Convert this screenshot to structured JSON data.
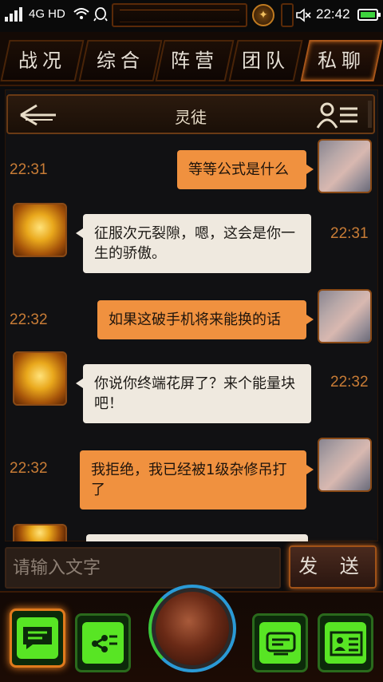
{
  "status_bar": {
    "network": "4G HD",
    "time": "22:42"
  },
  "tabs": [
    {
      "label": "战况",
      "active": false
    },
    {
      "label": "综合",
      "active": false
    },
    {
      "label": "阵营",
      "active": false
    },
    {
      "label": "团队",
      "active": false
    },
    {
      "label": "私聊",
      "active": true
    }
  ],
  "chat_header": {
    "title": "灵徒",
    "back_icon": "back-arrow-icon",
    "members_icon": "member-list-icon"
  },
  "messages": [
    {
      "direction": "out",
      "time": "22:31",
      "text": "等等公式是什么"
    },
    {
      "direction": "in",
      "time": "22:31",
      "text": "征服次元裂隙，嗯，这会是你一生的骄傲。"
    },
    {
      "direction": "out",
      "time": "22:32",
      "text": "如果这破手机将来能换的话"
    },
    {
      "direction": "in",
      "time": "22:32",
      "text": "你说你终端花屏了？来个能量块吧！"
    },
    {
      "direction": "out",
      "time": "22:32",
      "text": "我拒绝，我已经被1级杂修吊打了"
    }
  ],
  "input": {
    "placeholder": "请输入文字",
    "send_label": "发 送"
  },
  "bottom_nav": [
    {
      "icon": "chat-icon",
      "active": true
    },
    {
      "icon": "share-icon",
      "active": false
    },
    {
      "icon": "orb-globe-icon",
      "active": false
    },
    {
      "icon": "terminal-icon",
      "active": false
    },
    {
      "icon": "profile-card-icon",
      "active": false
    }
  ],
  "colors": {
    "accent": "#f0913f",
    "incoming_bubble": "#efe9df",
    "timestamp": "#c87c36",
    "nav_green": "#58e524"
  }
}
